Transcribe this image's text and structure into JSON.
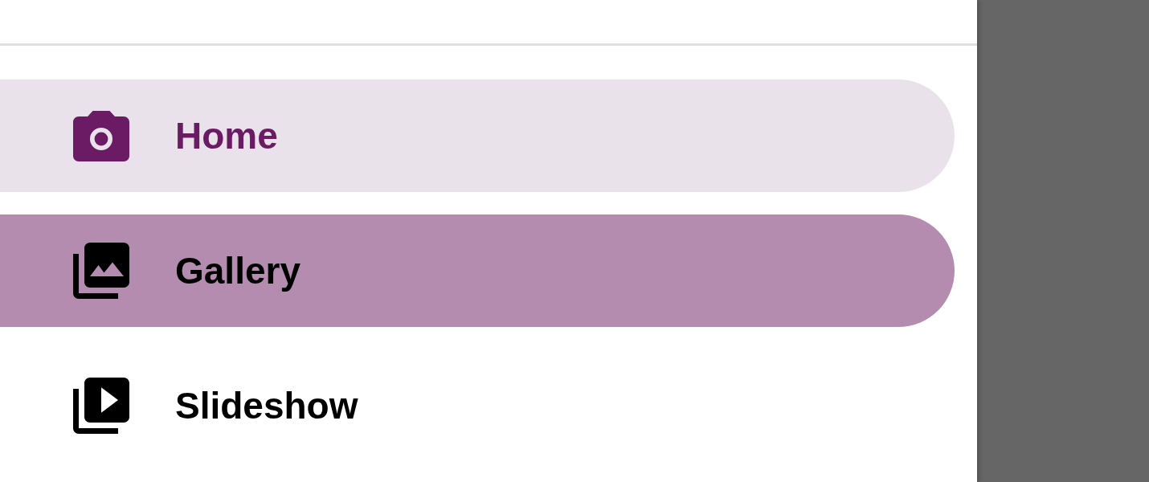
{
  "drawer": {
    "items": [
      {
        "label": "Home",
        "selected": true,
        "pressed": false
      },
      {
        "label": "Gallery",
        "selected": false,
        "pressed": true
      },
      {
        "label": "Slideshow",
        "selected": false,
        "pressed": false
      }
    ]
  }
}
